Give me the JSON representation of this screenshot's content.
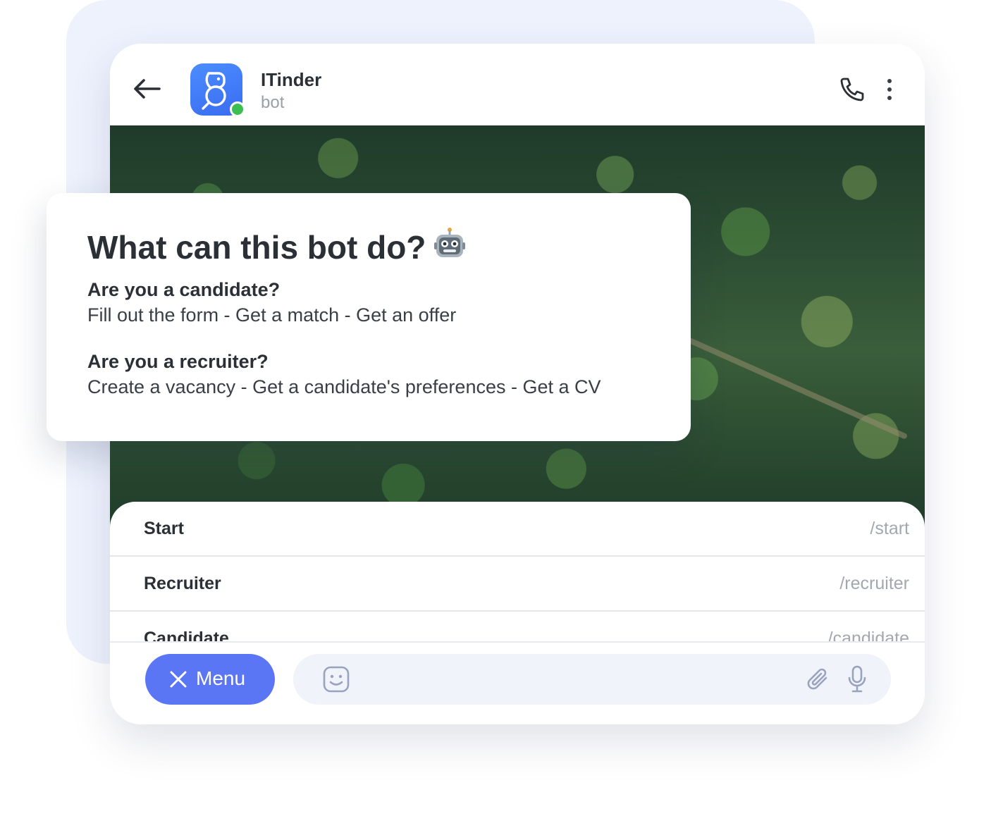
{
  "chat": {
    "bot_name": "ITinder",
    "bot_subtitle": "bot"
  },
  "description_card": {
    "title": "What can this bot do?",
    "title_emoji": "robot-face-icon",
    "sections": [
      {
        "heading": "Are you a candidate?",
        "text": "Fill out the form - Get a match - Get an offer"
      },
      {
        "heading": "Are you a recruiter?",
        "text": "Create a vacancy - Get a candidate's preferences - Get a CV"
      }
    ]
  },
  "commands": [
    {
      "name": "Start",
      "command": "/start"
    },
    {
      "name": "Recruiter",
      "command": "/recruiter"
    },
    {
      "name": "Candidate",
      "command": "/candidate"
    }
  ],
  "input_bar": {
    "menu_label": "Menu",
    "message_placeholder": ""
  },
  "colors": {
    "accent": "#5b76f5",
    "avatar": "#3f7af6",
    "online": "#3bbf52",
    "backdrop": "#eef2fd"
  },
  "icons": {
    "back": "arrow-left-icon",
    "call": "phone-icon",
    "more": "more-vertical-icon",
    "close": "close-icon",
    "emoji": "smile-icon",
    "attach": "paperclip-icon",
    "mic": "microphone-icon"
  }
}
